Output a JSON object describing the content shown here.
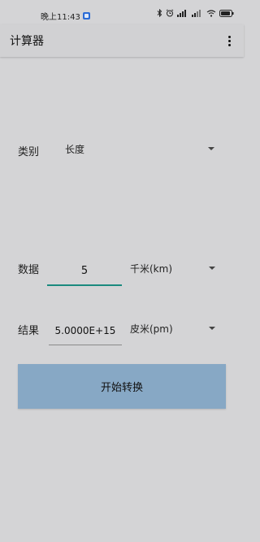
{
  "status_bar": {
    "time": "晚上11:43"
  },
  "app_bar": {
    "title": "计算器"
  },
  "category": {
    "label": "类别",
    "selected": "长度"
  },
  "data": {
    "label": "数据",
    "value": "5",
    "unit": "千米(km)"
  },
  "result": {
    "label": "结果",
    "value": "5.0000E+15",
    "unit": "皮米(pm)"
  },
  "convert_button": {
    "label": "开始转换"
  },
  "colors": {
    "background": "#d4d4d6",
    "accent_underline": "#1a8a7e",
    "button": "#87a8c5"
  }
}
